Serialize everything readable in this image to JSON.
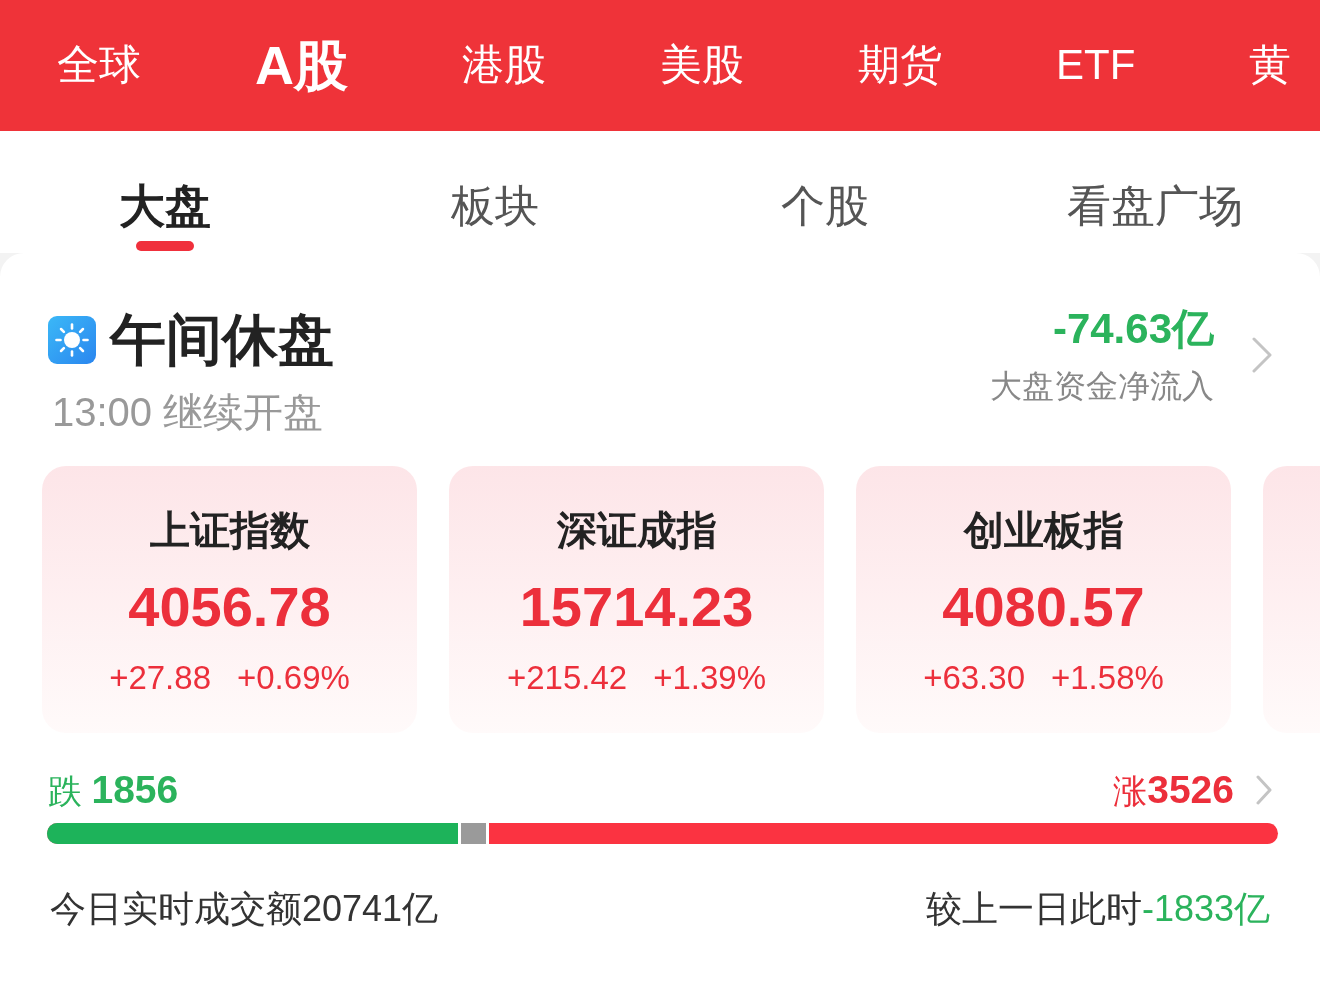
{
  "market_tabs": [
    {
      "label": "全球",
      "selected": false
    },
    {
      "label": "A股",
      "selected": true
    },
    {
      "label": "港股",
      "selected": false
    },
    {
      "label": "美股",
      "selected": false
    },
    {
      "label": "期货",
      "selected": false
    },
    {
      "label": "ETF",
      "selected": false
    },
    {
      "label": "黄",
      "selected": false
    }
  ],
  "sub_tabs": [
    {
      "label": "大盘",
      "selected": true
    },
    {
      "label": "板块",
      "selected": false
    },
    {
      "label": "个股",
      "selected": false
    },
    {
      "label": "看盘广场",
      "selected": false
    }
  ],
  "session": {
    "title": "午间休盘",
    "note": "13:00 继续开盘"
  },
  "net_flow": {
    "value": "-74.63亿",
    "falling": true,
    "label": "大盘资金净流入"
  },
  "indices": [
    {
      "name": "上证指数",
      "value": "4056.78",
      "change": "+27.88",
      "change_pct": "+0.69%",
      "falling": false
    },
    {
      "name": "深证成指",
      "value": "15714.23",
      "change": "+215.42",
      "change_pct": "+1.39%",
      "falling": false
    },
    {
      "name": "创业板指",
      "value": "4080.57",
      "change": "+63.30",
      "change_pct": "+1.58%",
      "falling": false
    }
  ],
  "breadth": {
    "decline": "跌 **1856**",
    "advance": "涨**3526**",
    "fills": [
      {
        "level": 0.336,
        "color": "#1db35a"
      },
      {
        "level": 0.359,
        "color": "#9a9a9a"
      }
    ]
  },
  "turnover": {
    "text": "今日实时成交额20741亿",
    "compare_label": "较上一日此时",
    "compare_value": "-1833亿",
    "compare_falling": true
  }
}
